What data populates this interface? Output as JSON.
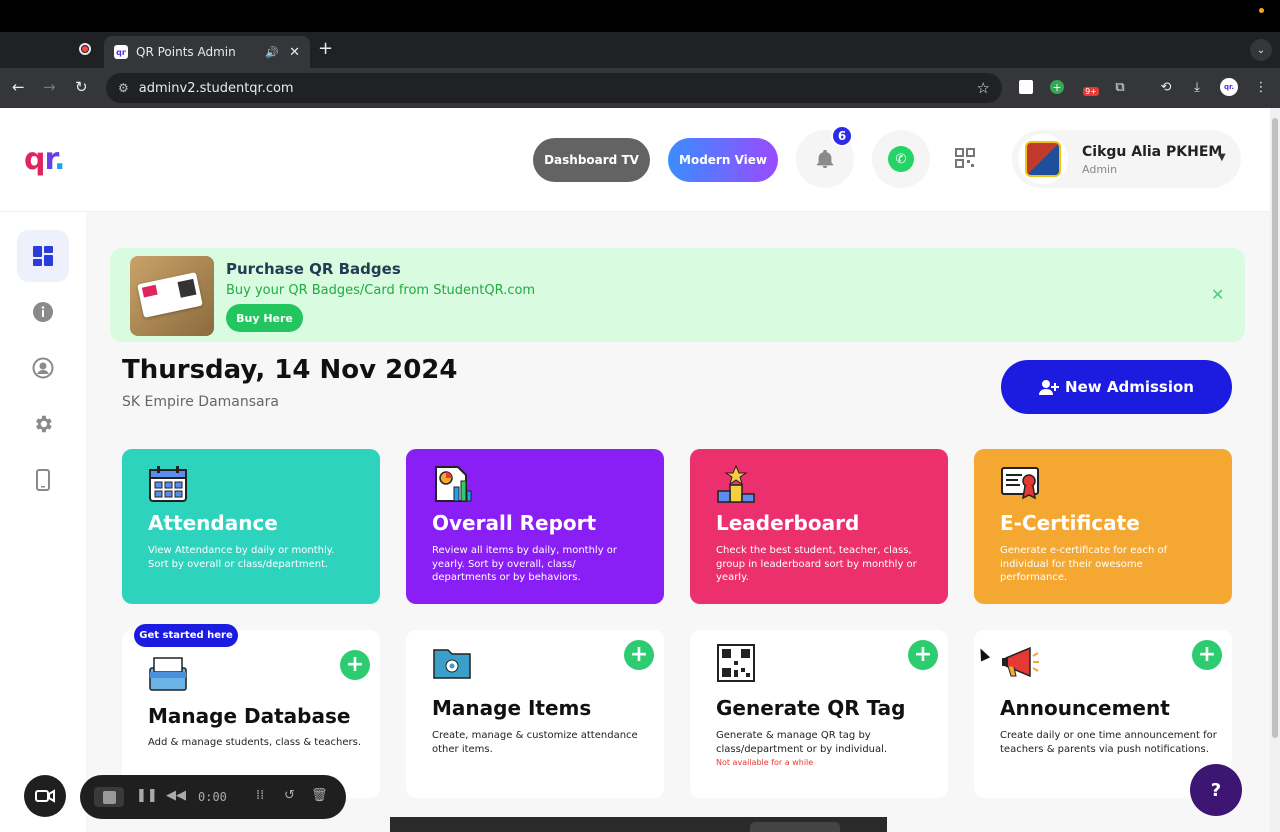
{
  "browser": {
    "tab_title": "QR Points Admin",
    "tab_favicon_text": "qr",
    "url": "adminv2.studentqr.com",
    "extension_badge": "9+",
    "profile_text": "qr."
  },
  "header": {
    "logo": {
      "q": "q",
      "r": "r",
      "dot": "."
    },
    "dashboard_tv_label": "Dashboard TV",
    "modern_view_label": "Modern View",
    "notification_count": "6",
    "user": {
      "name": "Cikgu Alia PKHEM",
      "role": "Admin"
    }
  },
  "sidebar": {
    "items": [
      {
        "icon": "dashboard-icon",
        "active": true
      },
      {
        "icon": "info-icon",
        "active": false
      },
      {
        "icon": "user-icon",
        "active": false
      },
      {
        "icon": "gear-icon",
        "active": false
      },
      {
        "icon": "mobile-icon",
        "active": false
      }
    ]
  },
  "promo": {
    "title": "Purchase QR Badges",
    "subtitle": "Buy your QR Badges/Card from StudentQR.com",
    "button_label": "Buy Here"
  },
  "main": {
    "date": "Thursday, 14 Nov 2024",
    "school": "SK Empire Damansara",
    "new_admission_label": "New Admission"
  },
  "tiles": [
    {
      "title": "Attendance",
      "desc": "View Attendance by daily or monthly. Sort by overall or class/department.",
      "color": "#2ed3bd"
    },
    {
      "title": "Overall Report",
      "desc": "Review all items by daily, monthly or yearly. Sort by overall, class/ departments or by behaviors.",
      "color": "#8a1ff5"
    },
    {
      "title": "Leaderboard",
      "desc": "Check the best student, teacher, class, group in leaderboard sort by monthly or yearly.",
      "color": "#ec2f6d"
    },
    {
      "title": "E-Certificate",
      "desc": "Generate e-certificate for each of individual for their owesome performance.",
      "color": "#f4a832"
    }
  ],
  "cards": [
    {
      "title": "Manage Database",
      "desc": "Add & manage students, class & teachers.",
      "warn": ""
    },
    {
      "title": "Manage Items",
      "desc": "Create, manage & customize attendance other items.",
      "warn": ""
    },
    {
      "title": "Generate QR Tag",
      "desc": "Generate & manage QR tag by class/department or by individual.",
      "warn": "Not available for a while"
    },
    {
      "title": "Announcement",
      "desc": "Create daily or one time announcement for teachers & parents via push notifications.",
      "warn": ""
    }
  ],
  "get_started_label": "Get started here",
  "help_label": "?",
  "recorder": {
    "time": "0:00"
  }
}
